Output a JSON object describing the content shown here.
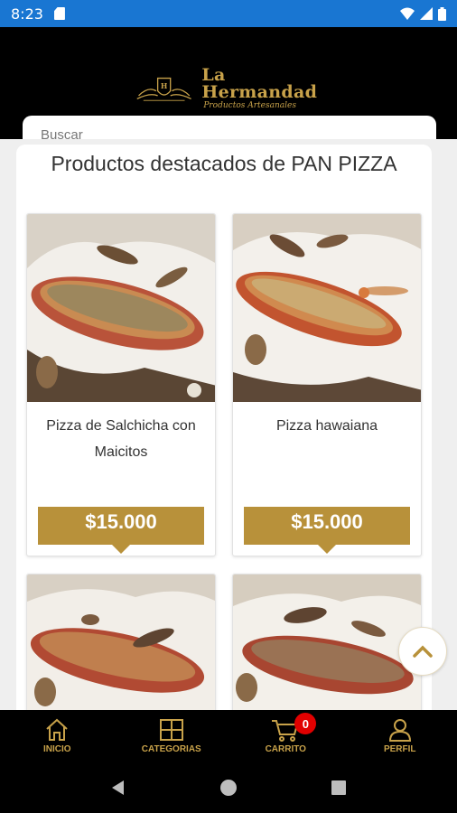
{
  "status": {
    "time": "8:23"
  },
  "header": {
    "brand": "La Hermandad",
    "tagline": "Productos Artesanales",
    "brand_color": "#c8a24a"
  },
  "search": {
    "placeholder": "Buscar"
  },
  "section": {
    "title": "Productos destacados de PAN PIZZA"
  },
  "products": [
    {
      "name": "Pizza de Salchicha con Maicitos",
      "price": "$15.000"
    },
    {
      "name": "Pizza hawaiana",
      "price": "$15.000"
    },
    {
      "name": "",
      "price": ""
    },
    {
      "name": "",
      "price": ""
    }
  ],
  "nav": {
    "items": [
      {
        "label": "INICIO",
        "icon": "home-icon"
      },
      {
        "label": "CATEGORIAS",
        "icon": "grid-icon"
      },
      {
        "label": "CARRITO",
        "icon": "cart-icon",
        "badge": "0"
      },
      {
        "label": "PERFIL",
        "icon": "user-icon"
      }
    ]
  },
  "colors": {
    "accent": "#b8913a",
    "status_bar": "#1976d2",
    "badge": "#e10000"
  }
}
